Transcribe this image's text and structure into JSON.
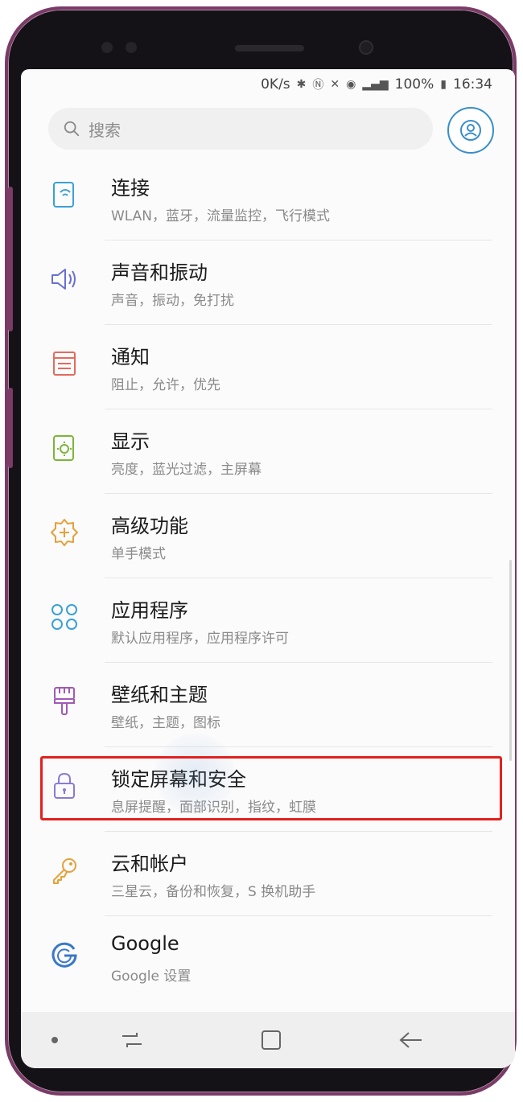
{
  "status_bar": {
    "speed": "0K/s",
    "battery": "100%",
    "time": "16:34"
  },
  "search": {
    "placeholder": "搜索"
  },
  "settings_items": [
    {
      "title": "连接",
      "subtitle": "WLAN，蓝牙，流量监控，飞行模式",
      "icon": "connection-icon",
      "color": "#3aa0d8"
    },
    {
      "title": "声音和振动",
      "subtitle": "声音，振动，免打扰",
      "icon": "speaker-icon",
      "color": "#6a6fd1"
    },
    {
      "title": "通知",
      "subtitle": "阻止，允许，优先",
      "icon": "notification-icon",
      "color": "#e46a5f"
    },
    {
      "title": "显示",
      "subtitle": "亮度，蓝光过滤，主屏幕",
      "icon": "display-icon",
      "color": "#7bb53a"
    },
    {
      "title": "高级功能",
      "subtitle": "单手模式",
      "icon": "advanced-features-icon",
      "color": "#e5a13a"
    },
    {
      "title": "应用程序",
      "subtitle": "默认应用程序，应用程序许可",
      "icon": "apps-icon",
      "color": "#3aa0d8"
    },
    {
      "title": "壁纸和主题",
      "subtitle": "壁纸，主题，图标",
      "icon": "wallpaper-brush-icon",
      "color": "#a05ab5"
    },
    {
      "title": "锁定屏幕和安全",
      "subtitle": "息屏提醒，面部识别，指纹，虹膜",
      "icon": "lock-icon",
      "color": "#8a7bd1"
    },
    {
      "title": "云和帐户",
      "subtitle": "三星云，备份和恢复，S 换机助手",
      "icon": "key-icon",
      "color": "#e5a13a"
    },
    {
      "title": "Google",
      "subtitle": "Google 设置",
      "icon": "google-icon",
      "color": "#3a78c8"
    }
  ],
  "colors": {
    "highlight": "#e32020",
    "accent": "#3a8ec8",
    "phone_frame": "#7a3b67"
  }
}
